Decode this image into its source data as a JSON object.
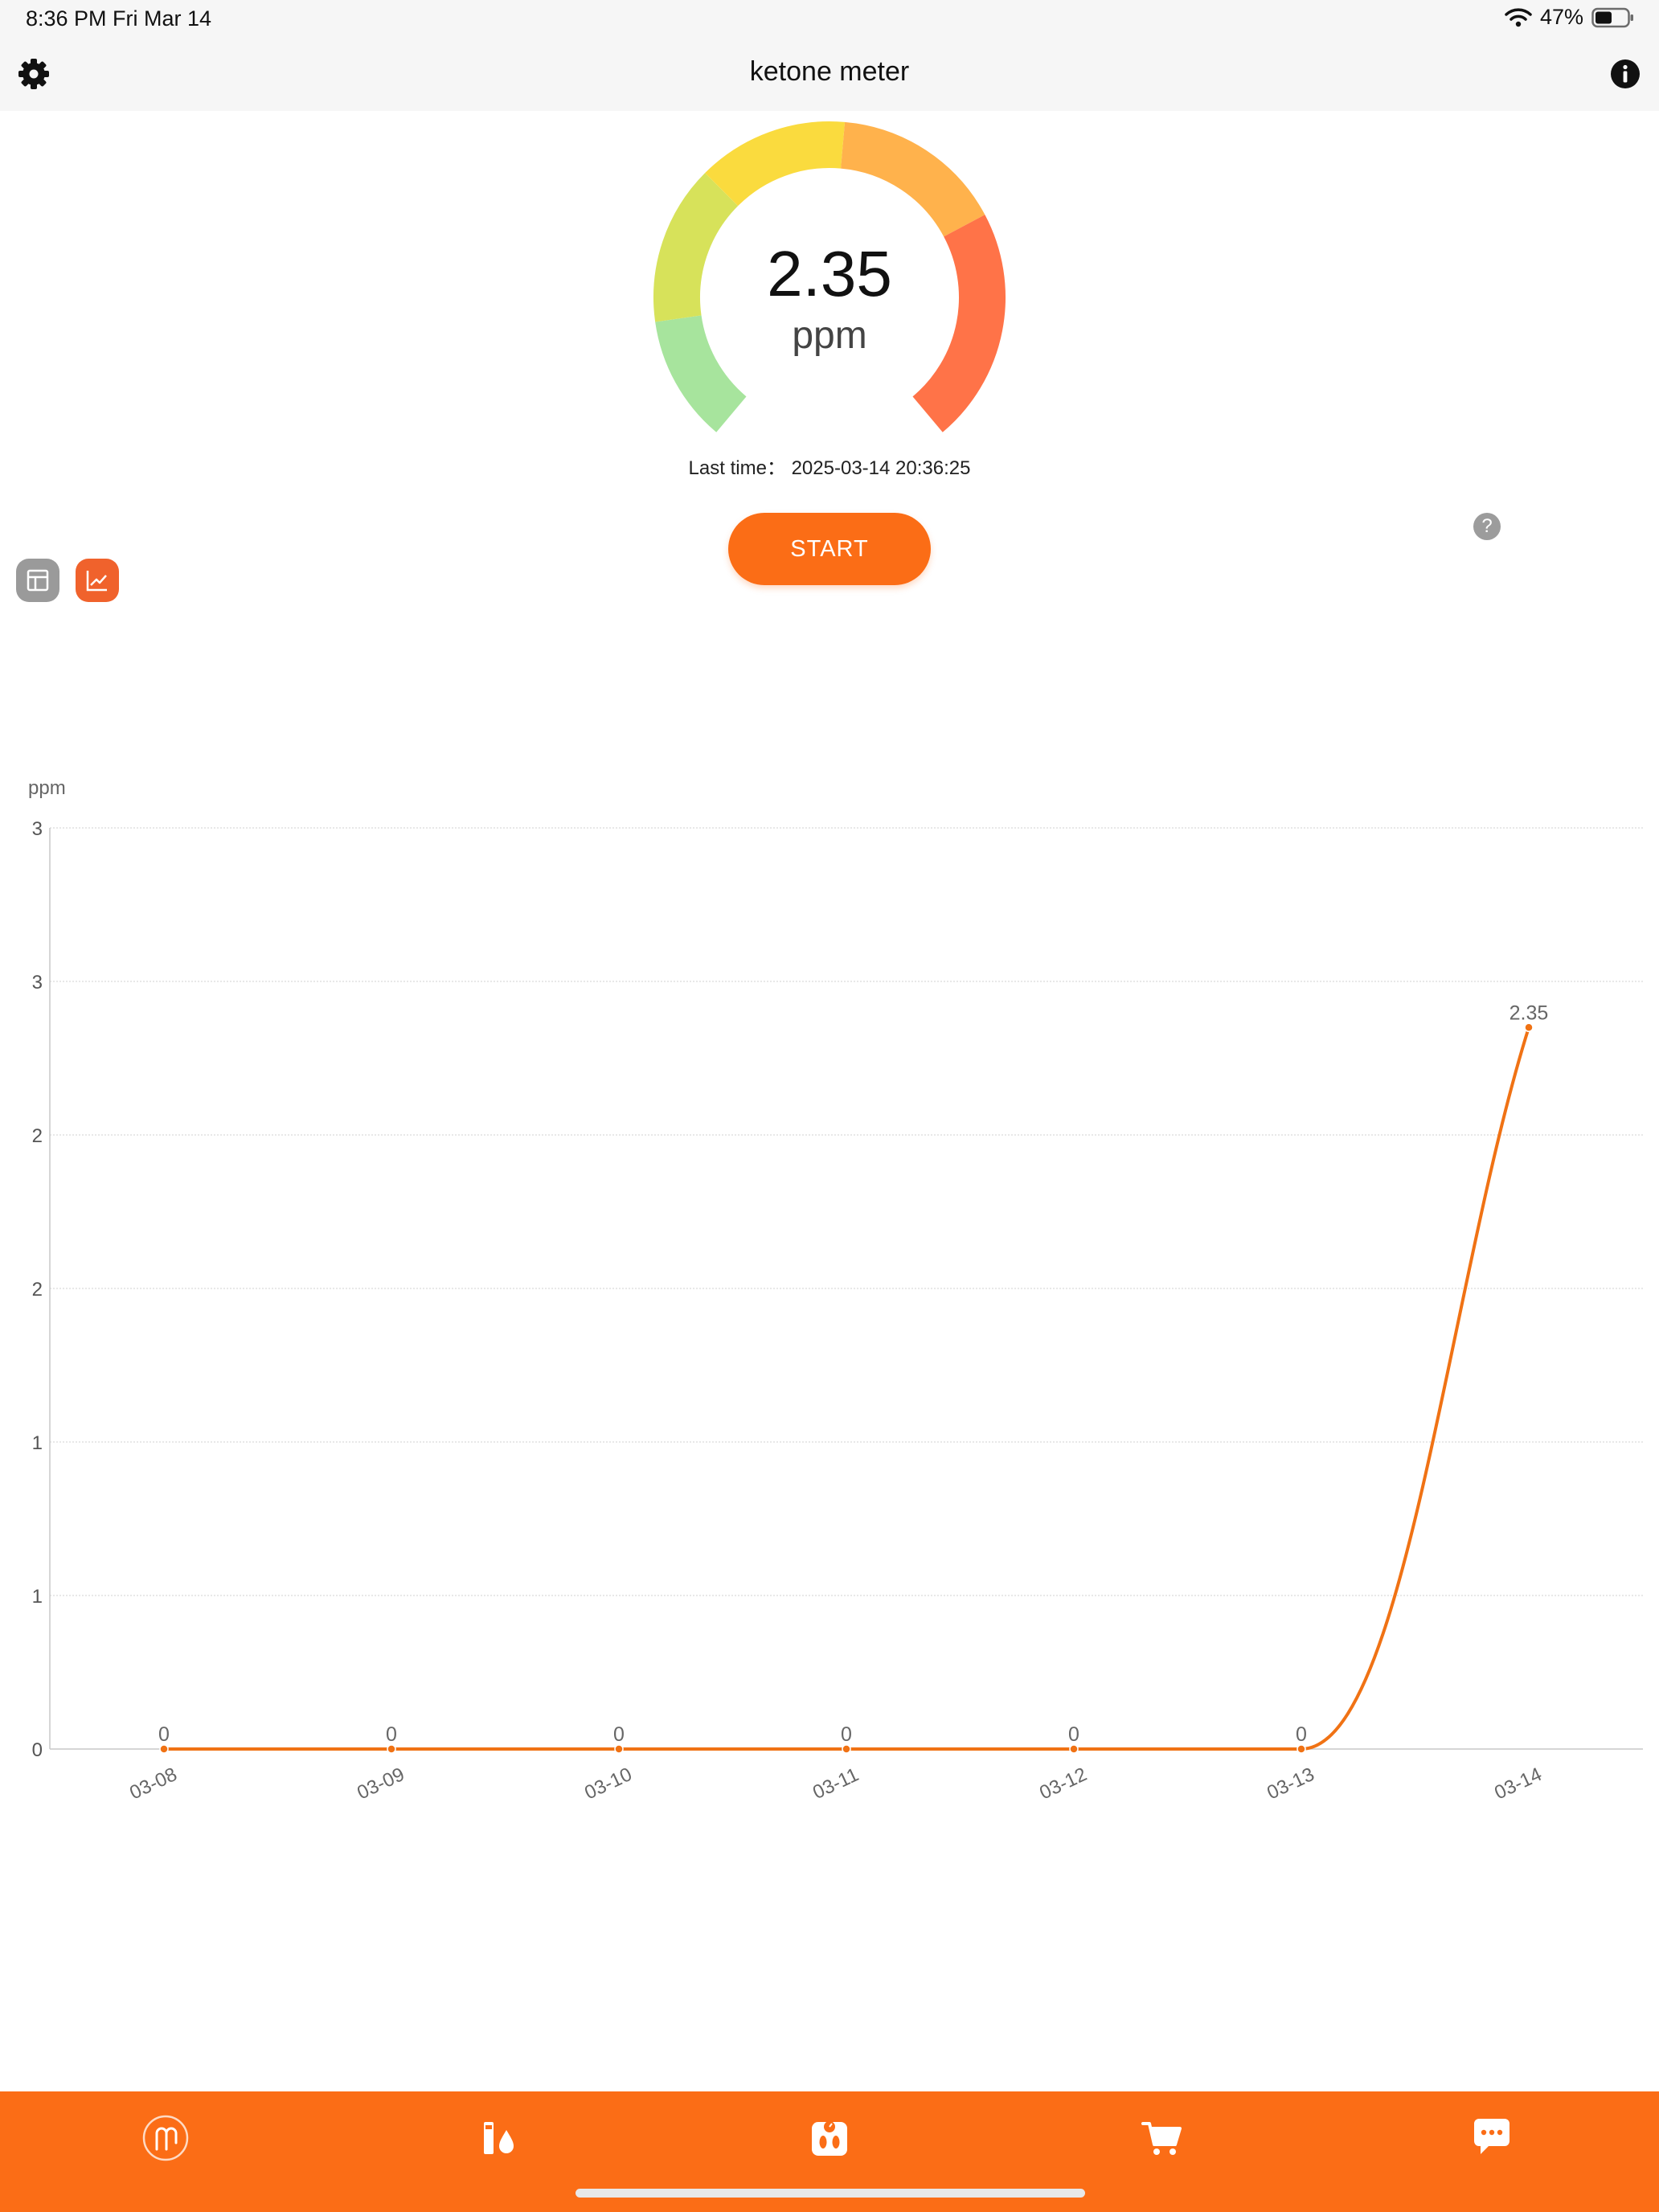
{
  "status_bar": {
    "time": "8:36 PM   Fri Mar 14",
    "battery": "47%"
  },
  "header": {
    "title": "ketone meter"
  },
  "gauge": {
    "value": "2.35",
    "unit": "ppm"
  },
  "last_time": "Last time： 2025-03-14 20:36:25",
  "start_label": "START",
  "help_label": "?",
  "colors": {
    "accent": "#fb6d16",
    "tabbar": "#fb6d16",
    "view_inactive": "#9a9a9a",
    "view_active": "#f0622c"
  },
  "tabs": [
    {
      "icon": "breath-logo-icon"
    },
    {
      "icon": "test-strip-drop-icon"
    },
    {
      "icon": "scale-icon"
    },
    {
      "icon": "cart-icon"
    },
    {
      "icon": "chat-icon"
    }
  ],
  "chart_data": {
    "type": "line",
    "ylabel": "ppm",
    "x": [
      "03-08",
      "03-09",
      "03-10",
      "03-11",
      "03-12",
      "03-13",
      "03-14"
    ],
    "y": [
      0,
      0,
      0,
      0,
      0,
      0,
      2.35
    ],
    "point_labels": [
      "0",
      "0",
      "0",
      "0",
      "0",
      "0",
      "2.35"
    ],
    "ylim": [
      0,
      3
    ],
    "y_ticks": [
      0,
      0.5,
      1,
      1.5,
      2,
      2.5,
      3
    ],
    "y_tick_labels": [
      "0",
      "1",
      "1",
      "2",
      "2",
      "3"
    ],
    "grid": true,
    "line_color": "#f07214"
  }
}
